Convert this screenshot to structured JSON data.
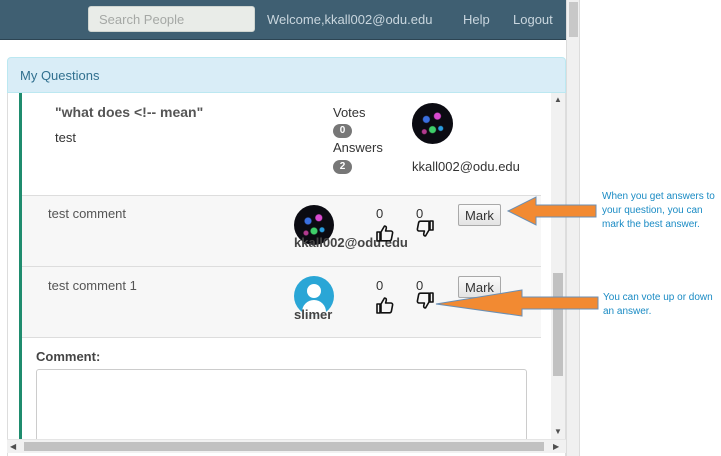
{
  "navbar": {
    "search_placeholder": "Search People",
    "welcome": "Welcome,kkall002@odu.edu",
    "help": "Help",
    "logout": "Logout"
  },
  "panel": {
    "title": "My Questions"
  },
  "question": {
    "title": "\"what does <!-- mean\"",
    "body": "test",
    "votes_label": "Votes",
    "votes": "0",
    "answers_label": "Answers",
    "answers": "2",
    "author": "kkall002@odu.edu"
  },
  "answers": [
    {
      "text": "test comment",
      "up": "0",
      "down": "0",
      "mark_label": "Mark",
      "author": "kkall002@odu.edu"
    },
    {
      "text": "test comment 1",
      "up": "0",
      "down": "0",
      "mark_label": "Mark",
      "author": "slimer"
    }
  ],
  "comment": {
    "label": "Comment:"
  },
  "annotations": {
    "mark_note": "When you get answers to your question, you can mark the best answer.",
    "vote_note": "You can vote up or down an answer."
  },
  "colors": {
    "navbar": "#3f5f72",
    "panel_header": "#d9edf7",
    "accent_bar": "#1f8c6e",
    "arrow": "#f28a32",
    "annotation_text": "#1a8bc4"
  },
  "icons": [
    "thumbs-up-icon",
    "thumbs-down-icon",
    "user-avatar-icon",
    "up-arrow-icon",
    "down-arrow-icon",
    "left-arrow-icon",
    "right-arrow-icon"
  ]
}
